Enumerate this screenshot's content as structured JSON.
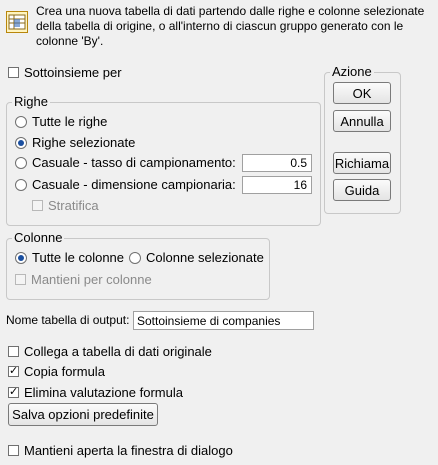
{
  "header": {
    "description": "Crea una nuova tabella di dati partendo dalle righe e colonne selezionate della tabella di origine, o all'interno di ciascun gruppo generato con le colonne 'By'.",
    "icon": "table-subset-icon"
  },
  "subset_by": {
    "label": "Sottoinsieme per",
    "checked": false
  },
  "rows_group": {
    "title": "Righe",
    "options": [
      {
        "label": "Tutte le righe",
        "selected": false
      },
      {
        "label": "Righe selezionate",
        "selected": true
      },
      {
        "label": "Casuale - tasso di campionamento:",
        "selected": false,
        "value": "0.5"
      },
      {
        "label": "Casuale - dimensione campionaria:",
        "selected": false,
        "value": "16"
      }
    ],
    "stratify": {
      "label": "Stratifica",
      "checked": false,
      "disabled": true
    }
  },
  "action_group": {
    "title": "Azione",
    "buttons": [
      "OK",
      "Annulla",
      "Richiama",
      "Guida"
    ]
  },
  "columns_group": {
    "title": "Colonne",
    "options": [
      {
        "label": "Tutte le colonne",
        "selected": true
      },
      {
        "label": "Colonne selezionate",
        "selected": false
      }
    ],
    "keep_by_columns": {
      "label": "Mantieni per colonne",
      "checked": false,
      "disabled": true
    }
  },
  "output_table": {
    "label": "Nome tabella di output:",
    "value": "Sottoinsieme di companies"
  },
  "options": [
    {
      "label": "Collega a tabella di dati originale",
      "checked": false
    },
    {
      "label": "Copia formula",
      "checked": true
    },
    {
      "label": "Elimina valutazione formula",
      "checked": true
    }
  ],
  "save_defaults_label": "Salva opzioni predefinite",
  "keep_dialog_open": {
    "label": "Mantieni aperta la finestra di dialogo",
    "checked": false
  }
}
